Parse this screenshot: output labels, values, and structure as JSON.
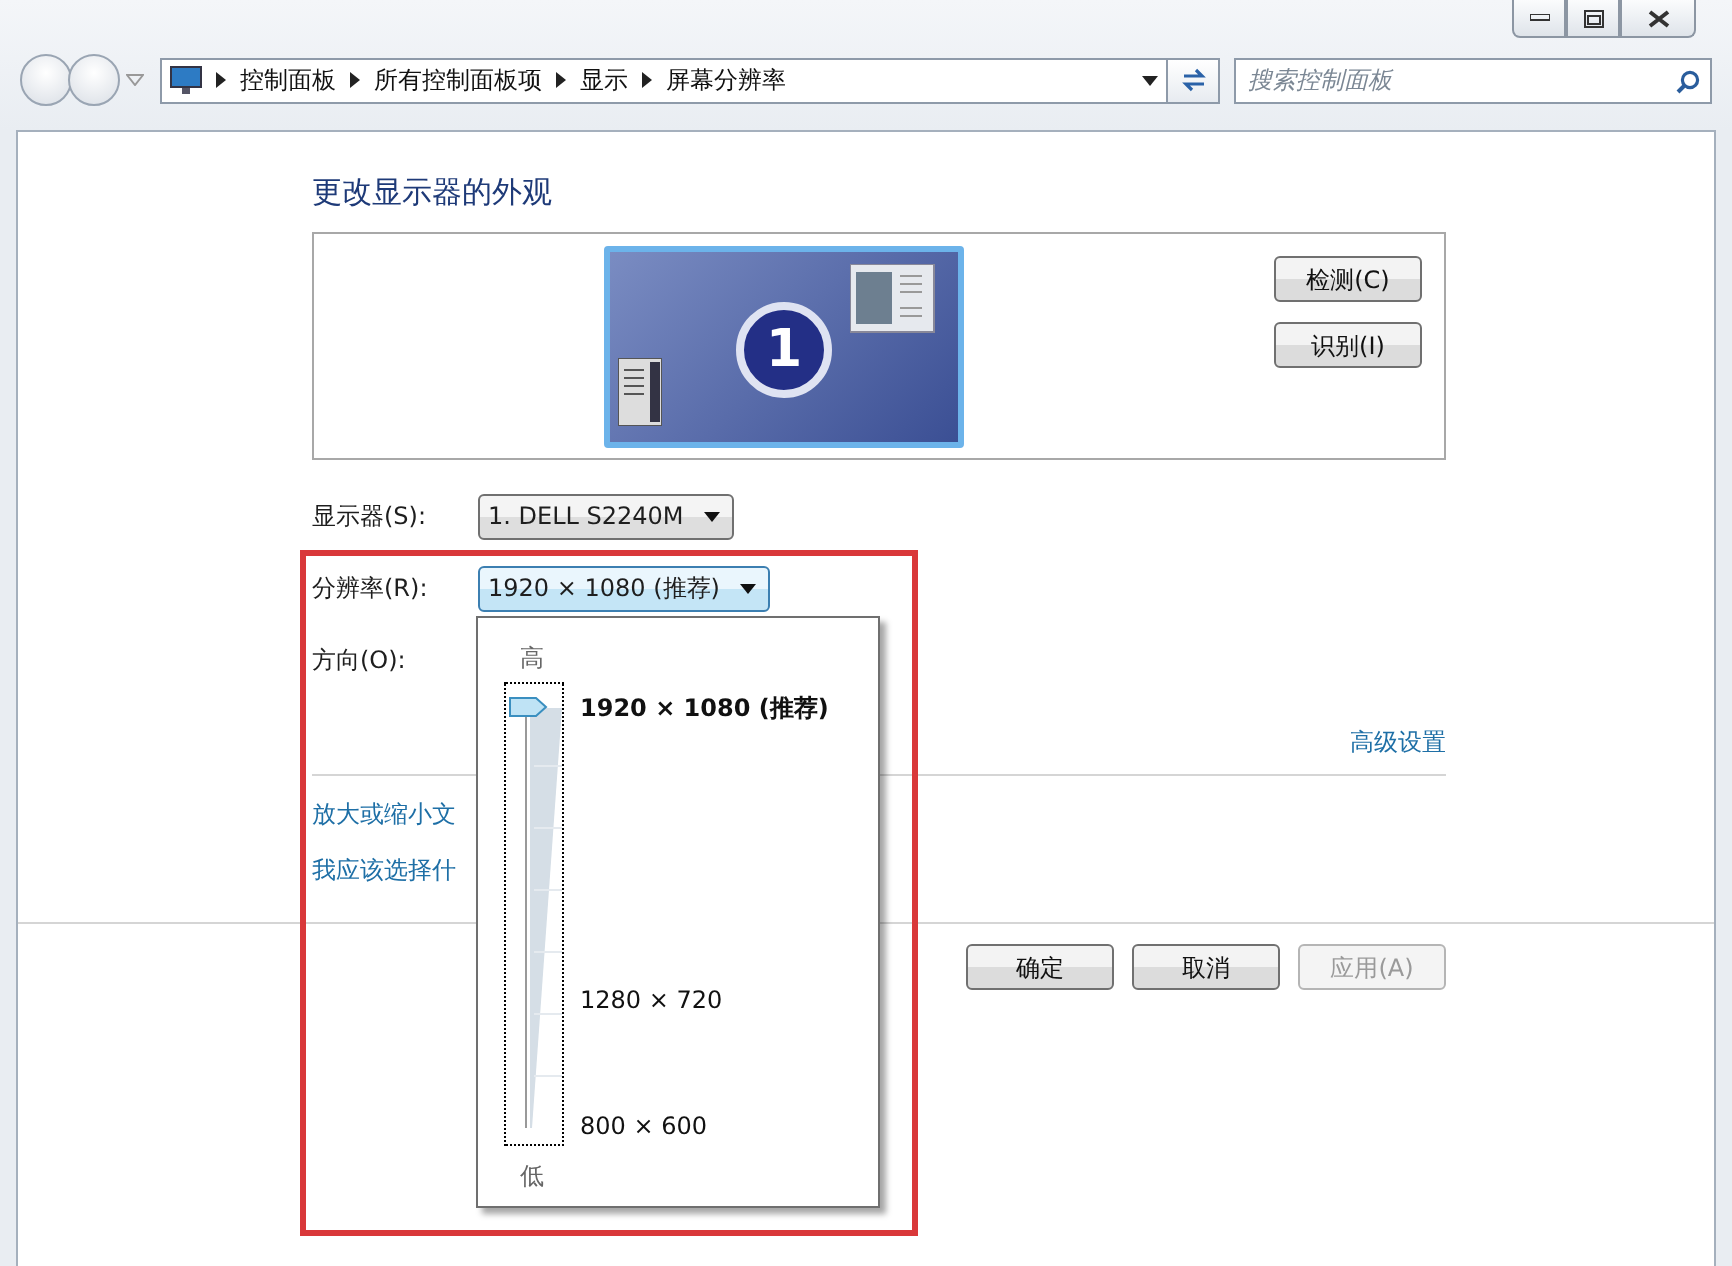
{
  "address_bar": {
    "breadcrumbs": [
      "控制面板",
      "所有控制面板项",
      "显示",
      "屏幕分辨率"
    ]
  },
  "search": {
    "placeholder": "搜索控制面板"
  },
  "heading": "更改显示器的外观",
  "preview": {
    "monitor_number": "1",
    "buttons": [
      "检测(C)",
      "识别(I)"
    ]
  },
  "settings": [
    {
      "label": "显示器(S):",
      "value": "1. DELL S2240M",
      "expanded": false
    },
    {
      "label": "分辨率(R):",
      "value": "1920 × 1080 (推荐)",
      "expanded": true
    },
    {
      "label": "方向(O):"
    }
  ],
  "resolution_popup": {
    "high_label": "高",
    "low_label": "低",
    "level": 1,
    "options": [
      {
        "label": "1920 × 1080 (推荐)",
        "selected": true
      },
      {
        "label": "1280 × 720",
        "selected": false
      },
      {
        "label": "800 × 600",
        "selected": false
      }
    ]
  },
  "advanced_link": "高级设置",
  "links": [
    "放大或缩小文",
    "我应该选择什"
  ],
  "buttons": [
    {
      "label": "确定",
      "disabled": false
    },
    {
      "label": "取消",
      "disabled": false
    },
    {
      "label": "应用(A)",
      "disabled": true
    }
  ]
}
